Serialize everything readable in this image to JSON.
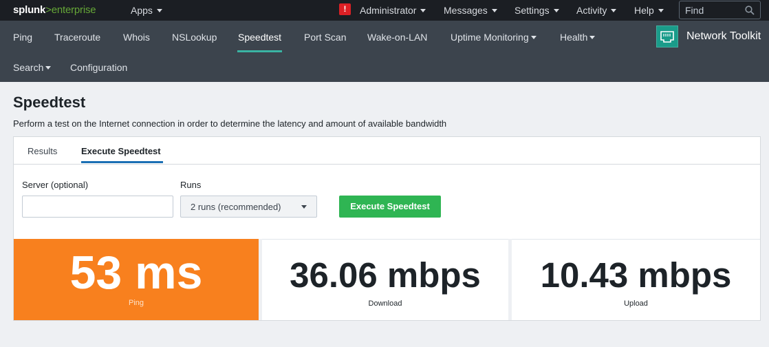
{
  "topbar": {
    "logo_splunk": "splunk",
    "logo_gt": ">",
    "logo_product": "enterprise",
    "apps": "Apps",
    "administrator": "Administrator",
    "messages": "Messages",
    "settings": "Settings",
    "activity": "Activity",
    "help": "Help",
    "find_placeholder": "Find",
    "alert_glyph": "!"
  },
  "appnav": {
    "items": [
      "Ping",
      "Traceroute",
      "Whois",
      "NSLookup",
      "Speedtest",
      "Port Scan",
      "Wake-on-LAN",
      "Uptime Monitoring",
      "Health",
      "Search",
      "Configuration"
    ],
    "active": "Speedtest",
    "brand": "Network Toolkit"
  },
  "page": {
    "title": "Speedtest",
    "description": "Perform a test on the Internet connection in order to determine the latency and amount of available bandwidth"
  },
  "tabs": {
    "results": "Results",
    "execute": "Execute Speedtest"
  },
  "form": {
    "server_label": "Server (optional)",
    "server_value": "",
    "runs_label": "Runs",
    "runs_value": "2 runs (recommended)",
    "execute_button": "Execute Speedtest"
  },
  "results": {
    "ping_value": "53 ms",
    "ping_label": "Ping",
    "download_value": "36.06 mbps",
    "download_label": "Download",
    "upload_value": "10.43 mbps",
    "upload_label": "Upload"
  },
  "colors": {
    "ping_tile": "#f8801e",
    "execute_button": "#2fb553",
    "alert": "#dc2025",
    "active_tab_underline": "#1a6fb4"
  }
}
